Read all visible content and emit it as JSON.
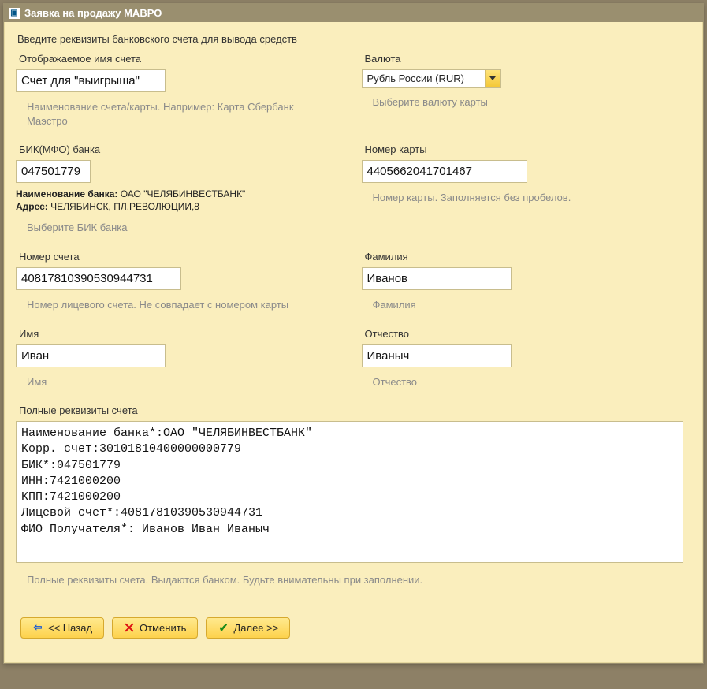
{
  "window": {
    "title": "Заявка на продажу МАВРО"
  },
  "intro": "Введите реквизиты банковского счета для вывода средств",
  "fields": {
    "account_name": {
      "label": "Отображаемое имя счета",
      "value": "Счет для \"выигрыша\"",
      "help": "Наименование счета/карты. Например: Карта Сбербанк Маэстро"
    },
    "currency": {
      "label": "Валюта",
      "value": "Рубль России (RUR)",
      "help": "Выберите валюту карты"
    },
    "bik": {
      "label": "БИК(МФО) банка",
      "value": "047501779",
      "bank_name_label": "Наименование банка:",
      "bank_name": "ОАО \"ЧЕЛЯБИНВЕСТБАНК\"",
      "address_label": "Адрес:",
      "address": "ЧЕЛЯБИНСК, ПЛ.РЕВОЛЮЦИИ,8",
      "help": "Выберите БИК банка"
    },
    "card": {
      "label": "Номер карты",
      "value": "4405662041701467",
      "help": "Номер карты. Заполняется без пробелов."
    },
    "account_no": {
      "label": "Номер счета",
      "value": "40817810390530944731",
      "help": "Номер лицевого счета. Не совпадает с номером карты"
    },
    "surname": {
      "label": "Фамилия",
      "value": "Иванов",
      "help": "Фамилия"
    },
    "name": {
      "label": "Имя",
      "value": "Иван",
      "help": "Имя"
    },
    "patronymic": {
      "label": "Отчество",
      "value": "Иваныч",
      "help": "Отчество"
    },
    "full": {
      "label": "Полные реквизиты счета",
      "value": "Наименование банка*:ОАО \"ЧЕЛЯБИНВЕСТБАНК\"\nКорр. счет:30101810400000000779\nБИК*:047501779\nИНН:7421000200\nКПП:7421000200\nЛицевой счет*:40817810390530944731\nФИО Получателя*: Иванов Иван Иваныч",
      "help": "Полные реквизиты счета. Выдаются банком. Будьте внимательны при заполнении."
    }
  },
  "buttons": {
    "back": "<< Назад",
    "cancel": "Отменить",
    "next": "Далее >>"
  }
}
